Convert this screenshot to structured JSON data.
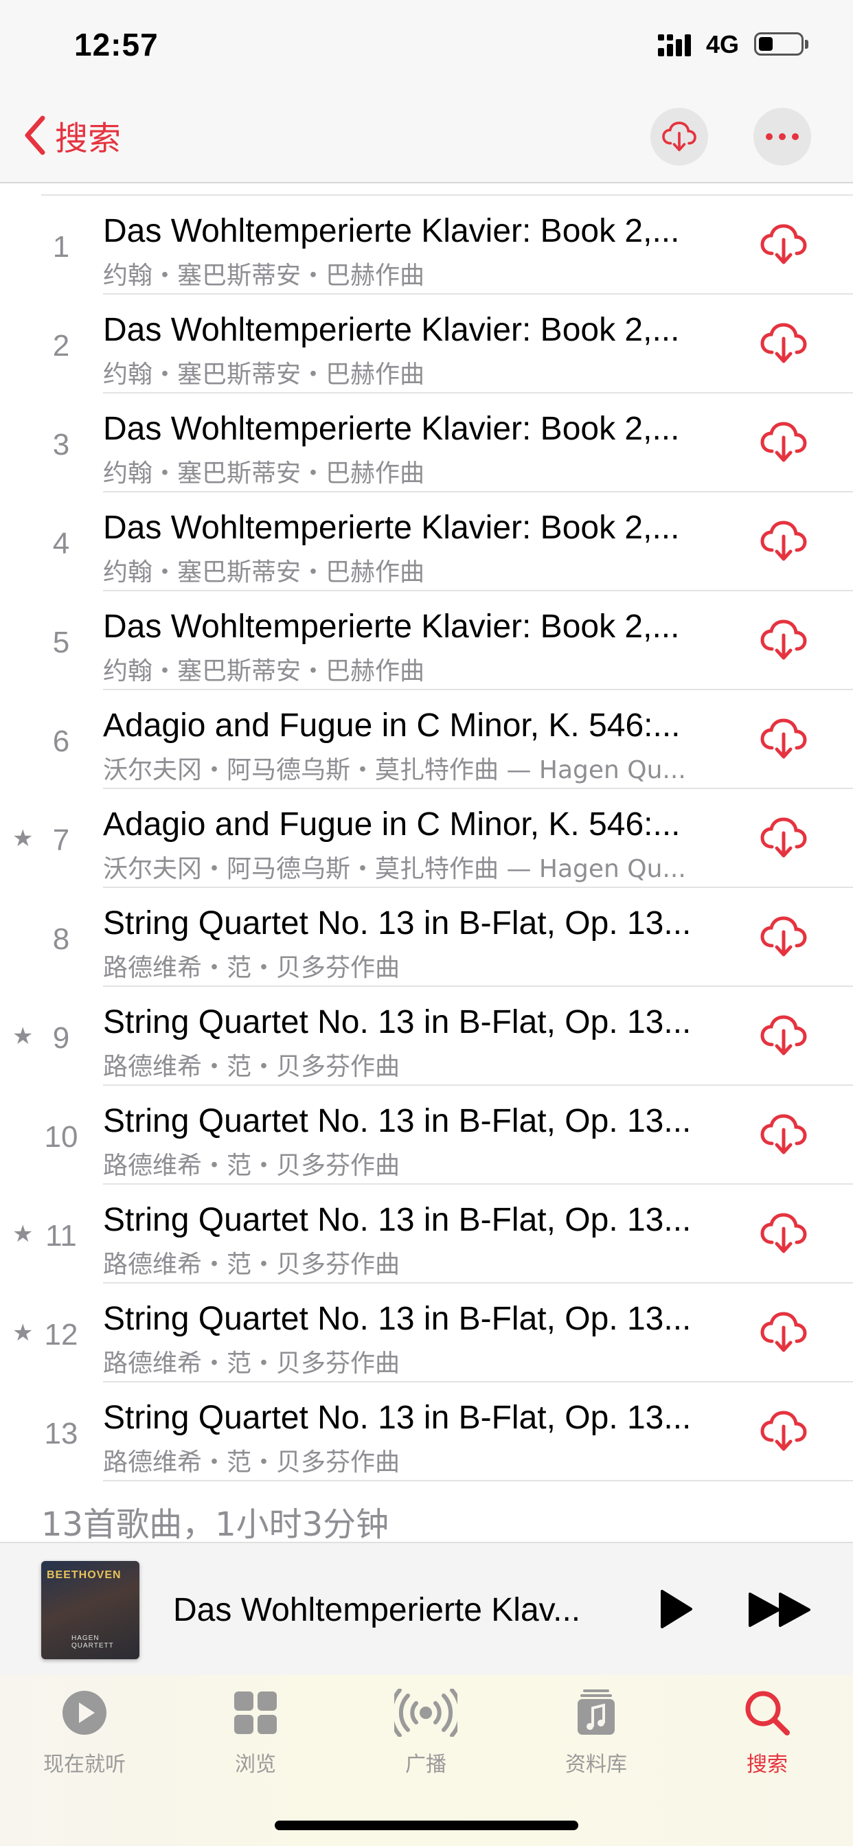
{
  "status_bar": {
    "time": "12:57",
    "network": "4G",
    "battery_level": 0.35
  },
  "nav": {
    "back_label": "搜索",
    "download_all_icon": "cloud-download-icon",
    "more_icon": "ellipsis-icon"
  },
  "tracks": [
    {
      "number": "1",
      "starred": false,
      "title": "Das Wohltemperierte Klavier: Book 2,...",
      "subtitle": "约翰・塞巴斯蒂安・巴赫作曲"
    },
    {
      "number": "2",
      "starred": false,
      "title": "Das Wohltemperierte Klavier: Book 2,...",
      "subtitle": "约翰・塞巴斯蒂安・巴赫作曲"
    },
    {
      "number": "3",
      "starred": false,
      "title": "Das Wohltemperierte Klavier: Book 2,...",
      "subtitle": "约翰・塞巴斯蒂安・巴赫作曲"
    },
    {
      "number": "4",
      "starred": false,
      "title": "Das Wohltemperierte Klavier: Book 2,...",
      "subtitle": "约翰・塞巴斯蒂安・巴赫作曲"
    },
    {
      "number": "5",
      "starred": false,
      "title": "Das Wohltemperierte Klavier: Book 2,...",
      "subtitle": "约翰・塞巴斯蒂安・巴赫作曲"
    },
    {
      "number": "6",
      "starred": false,
      "title": "Adagio and Fugue in C Minor, K. 546:...",
      "subtitle": "沃尔夫冈・阿马德乌斯・莫扎特作曲 — Hagen Qu..."
    },
    {
      "number": "7",
      "starred": true,
      "title": "Adagio and Fugue in C Minor, K. 546:...",
      "subtitle": "沃尔夫冈・阿马德乌斯・莫扎特作曲 — Hagen Qu..."
    },
    {
      "number": "8",
      "starred": false,
      "title": "String Quartet No. 13 in B-Flat, Op. 13...",
      "subtitle": "路德维希・范・贝多芬作曲"
    },
    {
      "number": "9",
      "starred": true,
      "title": "String Quartet No. 13 in B-Flat, Op. 13...",
      "subtitle": "路德维希・范・贝多芬作曲"
    },
    {
      "number": "10",
      "starred": false,
      "title": "String Quartet No. 13 in B-Flat, Op. 13...",
      "subtitle": "路德维希・范・贝多芬作曲"
    },
    {
      "number": "11",
      "starred": true,
      "title": "String Quartet No. 13 in B-Flat, Op. 13...",
      "subtitle": "路德维希・范・贝多芬作曲"
    },
    {
      "number": "12",
      "starred": true,
      "title": "String Quartet No. 13 in B-Flat, Op. 13...",
      "subtitle": "路德维希・范・贝多芬作曲"
    },
    {
      "number": "13",
      "starred": false,
      "title": "String Quartet No. 13 in B-Flat, Op. 13...",
      "subtitle": "路德维希・范・贝多芬作曲"
    }
  ],
  "summary": "13首歌曲，1小时3分钟",
  "now_playing": {
    "title": "Das Wohltemperierte Klav...",
    "artwork_title": "BEETHOVEN",
    "artwork_subtitle": "HAGEN QUARTETT",
    "play_icon": "play-icon",
    "forward_icon": "fast-forward-icon"
  },
  "tabs": [
    {
      "label": "现在就听",
      "icon": "play-circle-icon",
      "active": false
    },
    {
      "label": "浏览",
      "icon": "grid-icon",
      "active": false
    },
    {
      "label": "广播",
      "icon": "radio-broadcast-icon",
      "active": false
    },
    {
      "label": "资料库",
      "icon": "music-library-icon",
      "active": false
    },
    {
      "label": "搜索",
      "icon": "search-icon",
      "active": true
    }
  ],
  "colors": {
    "accent": "#e5333f",
    "secondary_text": "#8e8e93",
    "inactive_tab": "#9a9a9a"
  }
}
